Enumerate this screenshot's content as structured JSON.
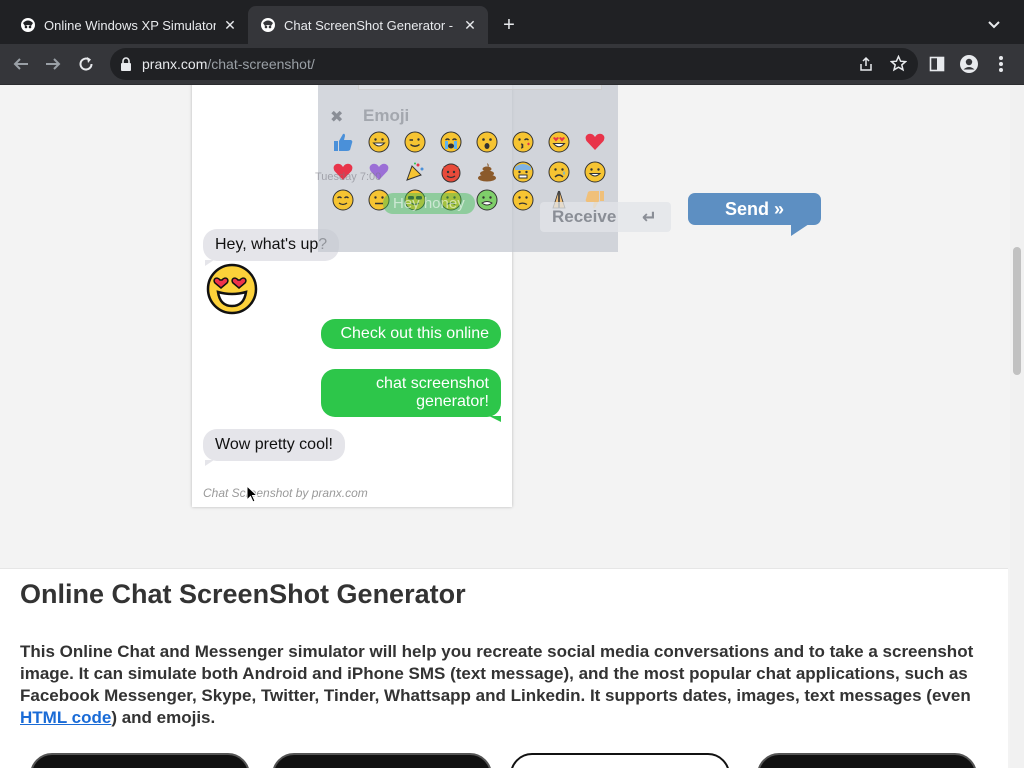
{
  "browser": {
    "tabs": [
      {
        "title": "Online Windows XP Simulator",
        "active": false
      },
      {
        "title": "Chat ScreenShot Generator - Fake",
        "active": true
      }
    ],
    "url_domain": "pranx.com",
    "url_path": "/chat-screenshot/"
  },
  "chat": {
    "messages": [
      {
        "side": "in",
        "text": "Hey, what's up?"
      },
      {
        "side": "in",
        "emoji": "heart-eyes"
      },
      {
        "side": "out",
        "text": "Check out this online"
      },
      {
        "side": "out",
        "text": "chat screenshot generator!"
      },
      {
        "side": "in",
        "text": "Wow pretty cool!"
      }
    ],
    "credit": "Chat Screenshot by pranx.com"
  },
  "emoji_picker": {
    "title": "Emoji",
    "ghost_date": "Tuesday 7:00",
    "ghost_bubble": "Hey honey",
    "emojis": [
      "thumbs-up",
      "grin",
      "wink",
      "cry",
      "surprised",
      "kiss",
      "heart-eyes",
      "heart",
      "purple-heart",
      "party",
      "devil",
      "poop",
      "fear",
      "sad",
      "smile",
      "blush",
      "neutral",
      "cool",
      "sick",
      "nauseated",
      "confused",
      "pray",
      "thumbs-down"
    ]
  },
  "controls": {
    "receive_label": "Receive",
    "send_label": "Send »"
  },
  "article": {
    "heading": "Online Chat ScreenShot Generator",
    "body_before": "This Online Chat and Messenger simulator will help you recreate social media conversations and to take a screenshot image. It can simulate both Android and iPhone SMS (text message), and the most popular chat applications, such as Facebook Messenger, Skype, Twitter, Tinder, Whattsapp and Linkedin. It supports dates, images, text messages (even ",
    "link_text": "HTML code",
    "body_after": ") and emojis."
  },
  "colors": {
    "outgoing_bubble": "#2dc64a",
    "incoming_bubble": "#e5e5ea",
    "send_button": "#5d8fc2",
    "link": "#1a6bd6"
  }
}
